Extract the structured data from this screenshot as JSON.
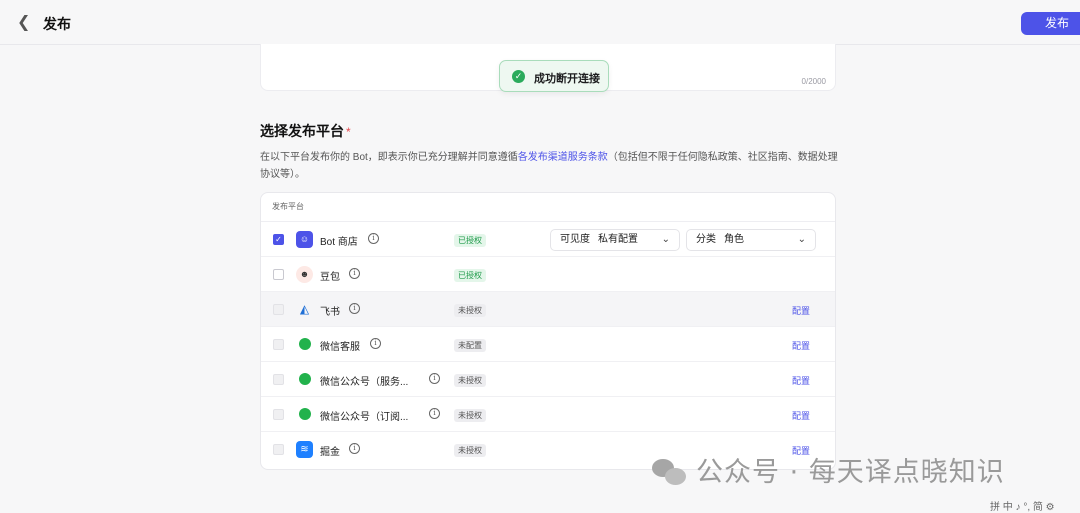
{
  "header": {
    "back_icon": "chevron-left-icon",
    "title": "发布",
    "publish_label": "发布"
  },
  "description": {
    "char_count": "0/2000"
  },
  "toast": {
    "icon": "check-circle-icon",
    "message": "成功断开连接"
  },
  "section": {
    "title": "选择发布平台",
    "required_mark": "*",
    "desc_prefix": "在以下平台发布你的 Bot，即表示你已充分理解并同意遵循",
    "desc_link": "各发布渠道服务条款",
    "desc_suffix": "（包括但不限于任何隐私政策、社区指南、数据处理协议等）。"
  },
  "table": {
    "header": "发布平台",
    "rows": [
      {
        "name": "Bot 商店",
        "icon": "bot-store-icon",
        "status": "已授权",
        "checked": true
      },
      {
        "name": "豆包",
        "icon": "doubao-icon",
        "status": "已授权",
        "checked": false
      },
      {
        "name": "飞书",
        "icon": "feishu-icon",
        "status": "未授权",
        "action": "配置"
      },
      {
        "name": "微信客服",
        "icon": "wechat-icon",
        "status": "未配置",
        "action": "配置"
      },
      {
        "name": "微信公众号（服务...",
        "icon": "wechat-icon",
        "status": "未授权",
        "action": "配置"
      },
      {
        "name": "微信公众号（订阅...",
        "icon": "wechat-icon",
        "status": "未授权",
        "action": "配置"
      },
      {
        "name": "掘金",
        "icon": "juejin-icon",
        "status": "未授权",
        "action": "配置"
      }
    ],
    "visibility": {
      "label": "可见度",
      "value": "私有配置"
    },
    "category": {
      "label": "分类",
      "value": "角色"
    }
  },
  "watermark": {
    "text": "公众号 · 每天译点晓知识"
  },
  "ime": {
    "text": "拼 中 ♪ °, 简 ⚙"
  },
  "colors": {
    "accent": "#4d53e8",
    "success": "#2bab5c"
  }
}
